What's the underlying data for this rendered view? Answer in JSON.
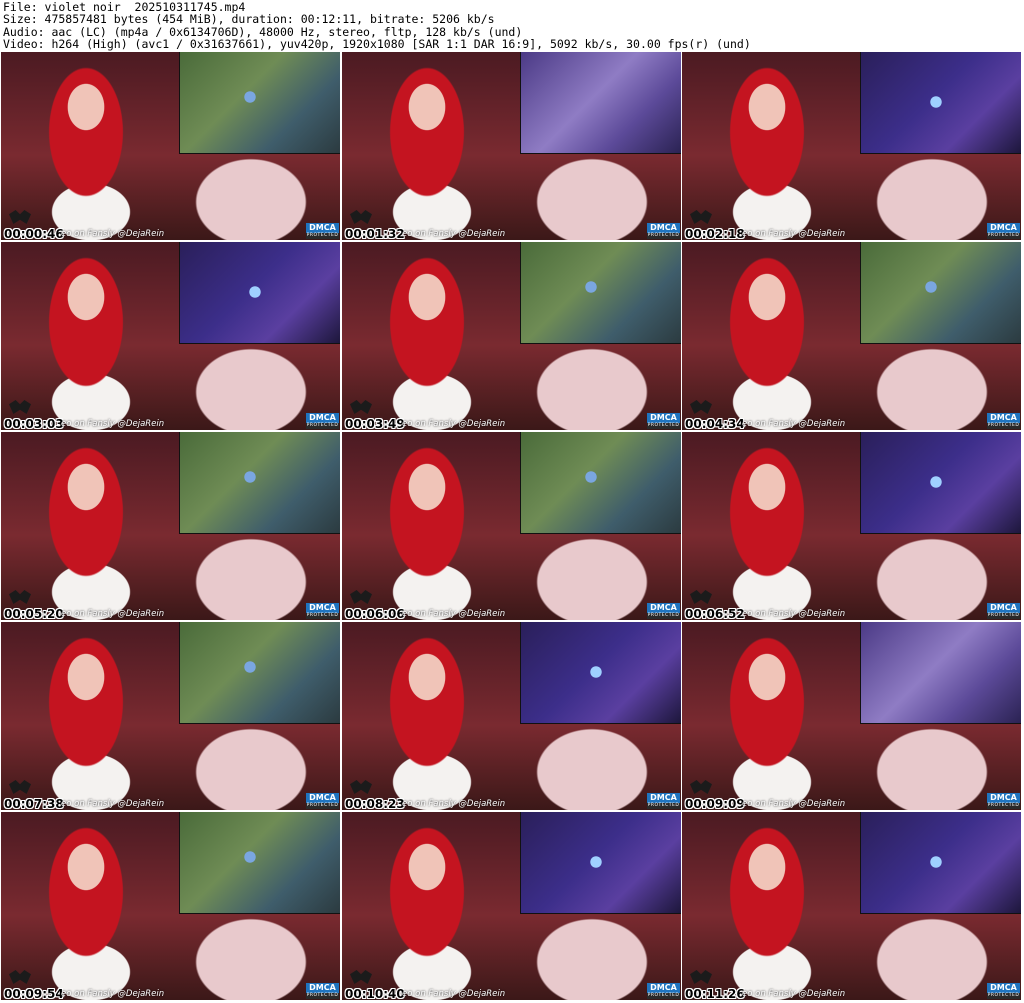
{
  "header": {
    "file_line": "File: violet_noir__202510311745.mp4",
    "size_line": "Size: 475857481 bytes (454 MiB), duration: 00:12:11, bitrate: 5206 kb/s",
    "audio_line": "Audio: aac (LC) (mp4a / 0x6134706D), 48000 Hz, stereo, fltp, 128 kb/s (und)",
    "video_line": "Video: h264 (High) (avc1 / 0x31637661), yuv420p, 1920x1080 [SAR 1:1 DAR 16:9], 5092 kb/s, 30.00 fps(r) (und)"
  },
  "overlay": {
    "watermark": "eo on Fansly @DejaRein",
    "dmca_top": "DMCA",
    "dmca_bottom": "PROTECTED"
  },
  "thumbnails": [
    {
      "timestamp": "00:00:46",
      "scene": "green"
    },
    {
      "timestamp": "00:01:32",
      "scene": "violetfog"
    },
    {
      "timestamp": "00:02:18",
      "scene": "purple"
    },
    {
      "timestamp": "00:03:03",
      "scene": "purple"
    },
    {
      "timestamp": "00:03:49",
      "scene": "green"
    },
    {
      "timestamp": "00:04:34",
      "scene": "green"
    },
    {
      "timestamp": "00:05:20",
      "scene": "green"
    },
    {
      "timestamp": "00:06:06",
      "scene": "green"
    },
    {
      "timestamp": "00:06:52",
      "scene": "purple"
    },
    {
      "timestamp": "00:07:38",
      "scene": "green"
    },
    {
      "timestamp": "00:08:23",
      "scene": "purple"
    },
    {
      "timestamp": "00:09:09",
      "scene": "violetfog"
    },
    {
      "timestamp": "00:09:54",
      "scene": "green"
    },
    {
      "timestamp": "00:10:40",
      "scene": "purple"
    },
    {
      "timestamp": "00:11:26",
      "scene": "purple"
    }
  ]
}
